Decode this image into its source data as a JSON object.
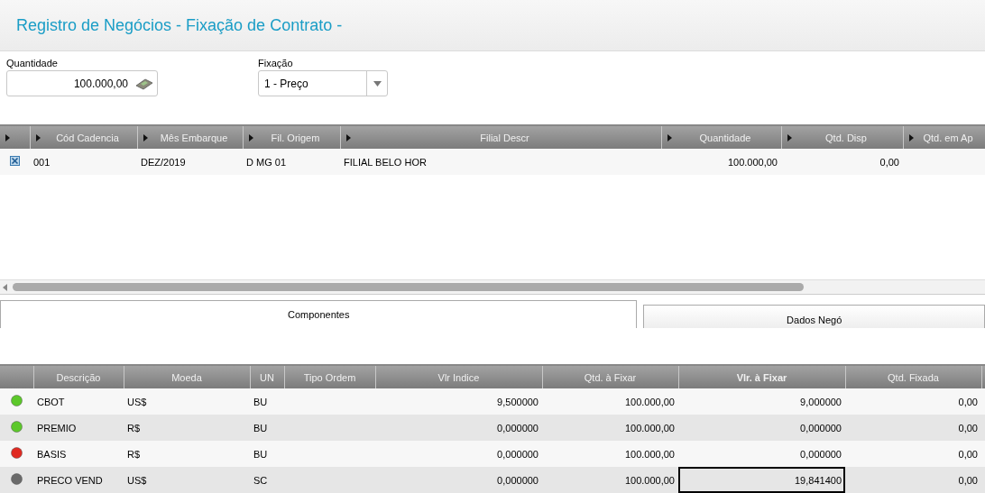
{
  "title": "Registro de Negócios - Fixação de Contrato -",
  "quantidade": {
    "label": "Quantidade",
    "value": "100.000,00"
  },
  "fixacao": {
    "label": "Fixação",
    "value": "1 - Preço"
  },
  "cadencias": {
    "columns": [
      "Cód Cadencia",
      "Mês Embarque",
      "Fil. Origem",
      "Filial Descr",
      "Quantidade",
      "Qtd. Disp",
      "Qtd. em Ap"
    ],
    "rows": [
      {
        "checked": true,
        "cells": [
          "001",
          "DEZ/2019",
          "D MG 01",
          "FILIAL BELO HOR",
          "100.000,00",
          "0,00",
          ""
        ]
      }
    ]
  },
  "tabs": [
    {
      "label": "Componentes",
      "selected": true
    },
    {
      "label": "Dados Negó",
      "selected": false
    }
  ],
  "componentes": {
    "columns": [
      {
        "label": "Descrição",
        "selected": false
      },
      {
        "label": "Moeda",
        "selected": false
      },
      {
        "label": "UN",
        "selected": false
      },
      {
        "label": "Tipo Ordem",
        "selected": false
      },
      {
        "label": "Vlr Indice",
        "selected": false
      },
      {
        "label": "Qtd. à Fixar",
        "selected": false
      },
      {
        "label": "Vlr. à Fixar",
        "selected": true
      },
      {
        "label": "Qtd. Fixada",
        "selected": false
      }
    ],
    "rows": [
      {
        "color": "#5cc82a",
        "focused": false,
        "cells": [
          "CBOT",
          "US$",
          "BU",
          "",
          "9,500000",
          "100.000,00",
          "9,000000",
          "0,00"
        ]
      },
      {
        "color": "#5cc82a",
        "focused": false,
        "cells": [
          "PREMIO",
          "R$",
          "BU",
          "",
          "0,000000",
          "100.000,00",
          "0,000000",
          "0,00"
        ]
      },
      {
        "color": "#e02a22",
        "focused": false,
        "cells": [
          "BASIS",
          "R$",
          "BU",
          "",
          "0,000000",
          "100.000,00",
          "0,000000",
          "0,00"
        ]
      },
      {
        "color": "#6a6a6a",
        "focused": true,
        "cells": [
          "PRECO VEND",
          "US$",
          "SC",
          "",
          "0,000000",
          "100.000,00",
          "19,841400",
          "0,00"
        ]
      }
    ]
  }
}
